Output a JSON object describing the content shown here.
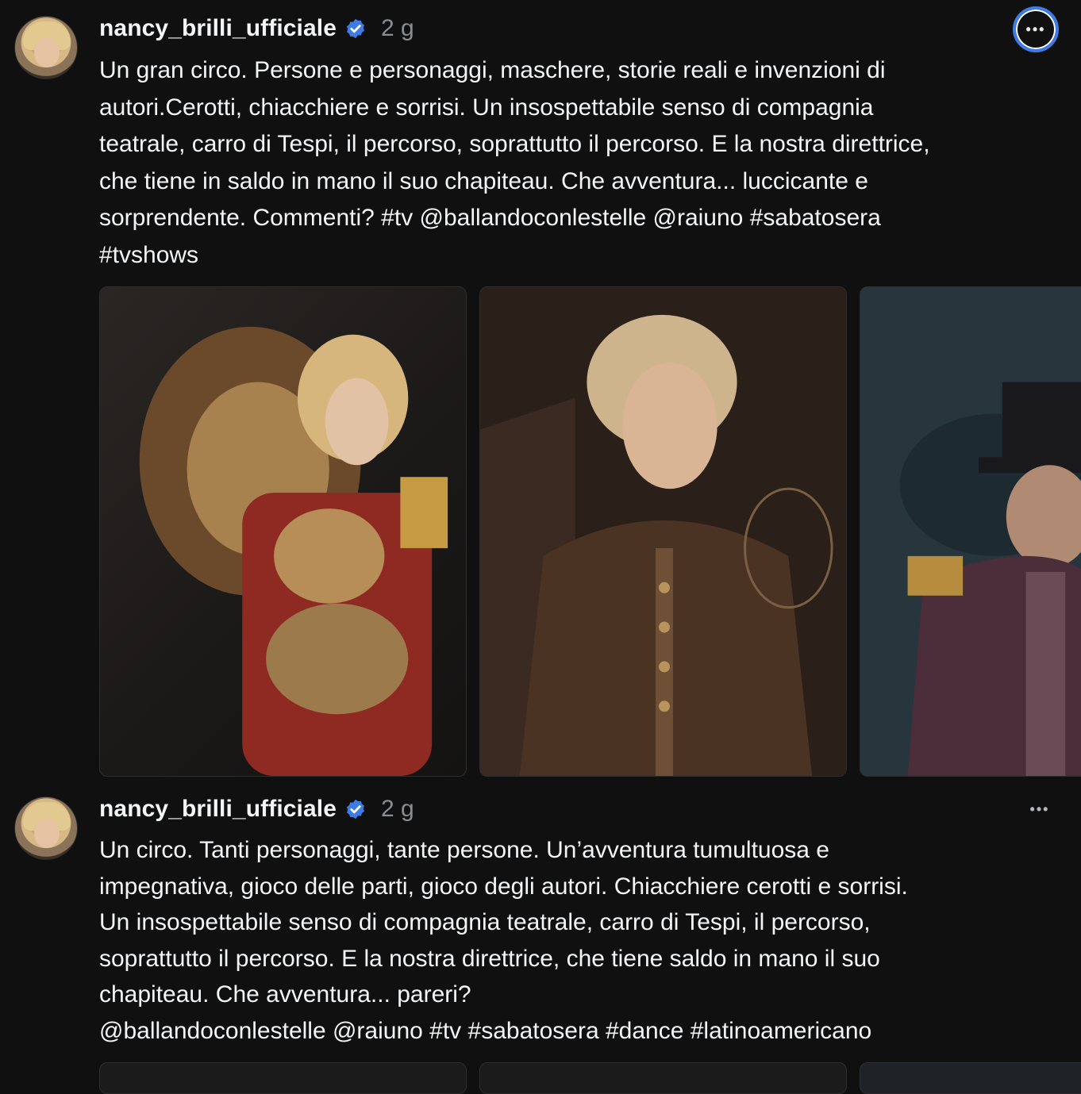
{
  "colors": {
    "background": "#101010",
    "text": "#f3f5f7",
    "muted": "#8a8d91",
    "verified": "#3f7be5",
    "focus_ring": "#3f7be5"
  },
  "posts": [
    {
      "username": "nancy_brilli_ufficiale",
      "time": "2 g",
      "more_label": "•••",
      "caption": "Un gran circo. Persone e personaggi, maschere, storie reali e invenzioni di\nautori.Cerotti, chiacchiere e sorrisi. Un insospettabile senso di compagnia\nteatrale, carro di Tespi, il percorso, soprattutto il percorso. E la nostra direttrice,\nche tiene in saldo in mano il suo chapiteau. Che avventura... luccicante e\nsorprendente. Commenti? #tv @ballandoconlestelle @raiuno #sabatosera\n#tvshows",
      "media": [
        {
          "icon": "photo-lion-tamer"
        },
        {
          "icon": "photo-butterflies"
        },
        {
          "icon": "photo-ringmaster"
        }
      ]
    },
    {
      "username": "nancy_brilli_ufficiale",
      "time": "2 g",
      "more_label": "•••",
      "caption": "Un circo. Tanti personaggi, tante persone. Un’avventura tumultuosa e\nimpegnativa, gioco delle parti, gioco degli autori. Chiacchiere cerotti e sorrisi.\nUn insospettabile senso di compagnia teatrale, carro di Tespi, il percorso,\nsoprattutto il percorso. E la nostra direttrice, che tiene saldo in mano il suo\nchapiteau. Che avventura... pareri?\n@ballandoconlestelle @raiuno #tv #sabatosera #dance #latinoamericano",
      "media": [
        {
          "icon": "photo"
        },
        {
          "icon": "photo"
        },
        {
          "icon": "photo"
        }
      ]
    }
  ]
}
